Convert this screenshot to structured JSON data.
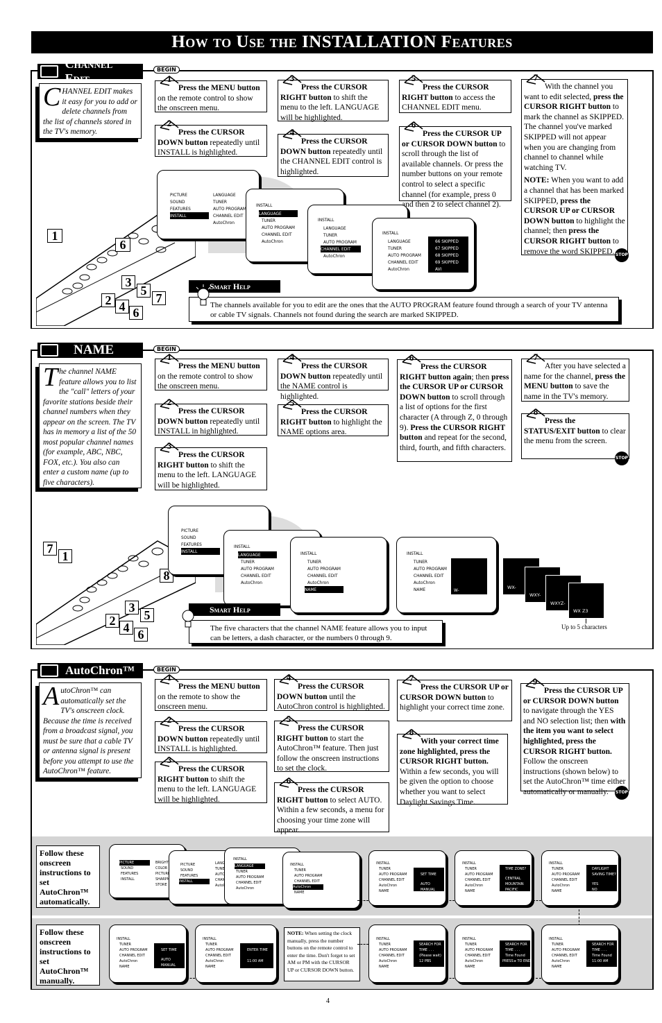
{
  "page_title": {
    "part1": "How to Use the ",
    "part2": "INSTALLATION",
    "part3": " Features"
  },
  "begin_label": "BEGIN",
  "stop_label": "STOP",
  "page_number": "4",
  "channel_edit": {
    "heading": "Channel Edit",
    "intro_drop": "C",
    "intro_text": "HANNEL EDIT makes it easy for you to add or delete channels from the list of channels stored in the TV's memory.",
    "steps": [
      {
        "num": "1",
        "bold": "Press the MENU button",
        "rest": " on the remote control to show the onscreen menu."
      },
      {
        "num": "2",
        "bold": "Press the CURSOR DOWN button",
        "rest": " repeatedly until INSTALL is highlighted."
      },
      {
        "num": "3",
        "bold": "Press the CURSOR RIGHT button",
        "rest": " to shift the menu to the left. LANGUAGE will be highlighted."
      },
      {
        "num": "4",
        "bold": "Press the CURSOR DOWN button",
        "rest": " repeatedly until the CHANNEL EDIT control is highlighted."
      },
      {
        "num": "5",
        "bold": "Press the CURSOR RIGHT button",
        "rest": " to access the CHANNEL EDIT menu."
      },
      {
        "num": "6",
        "bold": "Press the CURSOR UP or CURSOR DOWN button",
        "rest": " to scroll through the list of available channels. Or press the number buttons on your remote control to select a specific channel (for example, press 0 and then 2 to select channel 2)."
      },
      {
        "num": "7",
        "pre": "With the channel you want to edit selected, ",
        "bold": "press the CURSOR RIGHT button",
        "rest": " to mark the channel as SKIPPED. The channel you've marked SKIPPED will not appear when you are changing from channel to channel while watching TV.",
        "note_label": "NOTE:",
        "note_pre": " When you want to add a channel that has been marked SKIPPED, ",
        "note_bold1": "press the CURSOR UP or CURSOR DOWN button",
        "note_mid": " to highlight the channel; then ",
        "note_bold2": "press the CURSOR RIGHT button",
        "note_rest": " to remove the word SKIPPED."
      }
    ],
    "remote_callouts": [
      "1",
      "6",
      "3",
      "5",
      "7",
      "2",
      "4",
      "6"
    ],
    "smart_help_title": "Smart Help",
    "smart_help_text": "The channels available for you to edit are the ones that the AUTO PROGRAM feature found through a search of your TV antenna or cable TV signals.  Channels not found during the search are marked SKIPPED.",
    "screens": {
      "main_menu": [
        "PICTURE",
        "SOUND",
        "FEATURES",
        "INSTALL"
      ],
      "main_submenu": [
        "LANGUAGE",
        "TUNER",
        "AUTO PROGRAM",
        "CHANNEL EDIT",
        "AutoChron"
      ],
      "install_title": "INSTALL",
      "install_items": [
        "LANGUAGE",
        "TUNER",
        "AUTO PROGRAM",
        "CHANNEL EDIT",
        "AutoChron"
      ],
      "channel_list": [
        "66  SKIPPED",
        "67  SKIPPED",
        "68  SKIPPED",
        "69  SKIPPED",
        "AVI"
      ]
    }
  },
  "name": {
    "heading": "NAME",
    "intro_drop": "T",
    "intro_text": "he channel NAME feature allows you to list the \"call\" letters of your favorite stations beside their channel numbers when they appear on the screen.  The TV has in memory a list of the 50 most popular channel names (for example, ABC, NBC, FOX, etc.).  You also can enter a custom name (up to five characters).",
    "steps": [
      {
        "num": "1",
        "bold": "Press the MENU button",
        "rest": " on the remote control to show the onscreen menu."
      },
      {
        "num": "2",
        "bold": "Press the CURSOR DOWN button",
        "rest": " repeatedly until INSTALL in highlighted."
      },
      {
        "num": "3",
        "bold": "Press the CURSOR RIGHT button",
        "rest": " to shift the menu to the left. LANGUAGE will be highlighted."
      },
      {
        "num": "4",
        "bold": "Press the CURSOR DOWN button",
        "rest": " repeatedly until the NAME control is highlighted."
      },
      {
        "num": "5",
        "bold": "Press the CURSOR RIGHT button",
        "rest": " to highlight the NAME options area."
      },
      {
        "num": "6",
        "bold": "Press the CURSOR RIGHT button again",
        "rest": "; then ",
        "bold2": "press the CURSOR UP or CURSOR DOWN button",
        "rest2": " to scroll through a list of options for the first character (A through Z, 0 through 9).  ",
        "bold3": "Press the CURSOR RIGHT button",
        "rest3": " and repeat for the second, third, fourth, and fifth characters."
      },
      {
        "num": "7",
        "pre": "After you have selected a name for the channel, ",
        "bold": "press the MENU button",
        "rest": " to save the name in the TV's memory."
      },
      {
        "num": "8",
        "bold": "Press the STATUS/EXIT button",
        "rest": " to clear the menu from the screen."
      }
    ],
    "remote_callouts": [
      "7",
      "1",
      "8",
      "3",
      "5",
      "2",
      "4",
      "6"
    ],
    "smart_help_title": "Smart Help",
    "smart_help_text": "The five characters that the channel NAME feature allows you to input can be letters, a dash character, or the numbers 0 through 9.",
    "screens": {
      "main_menu": [
        "PICTURE",
        "SOUND",
        "FEATURES",
        "INSTALL"
      ],
      "install_title": "INSTALL",
      "install_items_a": [
        "LANGUAGE",
        "TUNER",
        "AUTO PROGRAM",
        "CHANNEL EDIT",
        "AutoChron"
      ],
      "install_items_b": [
        "TUNER",
        "AUTO PROGRAM",
        "CHANNEL EDIT",
        "AutoChron",
        "NAME"
      ],
      "name_entries": [
        "W-",
        "WX-",
        "WXY-",
        "WXYZ-",
        "WX Z3"
      ],
      "caption": "Up to 5 characters"
    }
  },
  "autochron": {
    "heading": "AutoChron™",
    "intro_drop": "A",
    "intro_text": "utoChron™ can automatically set the TV's onscreen clock.  Because the time is received from a broadcast signal, you must be sure that a cable TV or antenna signal is present before you attempt to use the AutoChron™ feature.",
    "steps": [
      {
        "num": "1",
        "bold": "Press the MENU button",
        "rest": " on the remote to show the onscreen menu."
      },
      {
        "num": "2",
        "bold": "Press the CURSOR DOWN button",
        "rest": " repeatedly until INSTALL is highlighted."
      },
      {
        "num": "3",
        "bold": "Press the CURSOR RIGHT button",
        "rest": " to shift the menu to the left. LANGUAGE will be highlighted."
      },
      {
        "num": "4",
        "bold": "Press the CURSOR DOWN button",
        "rest": " until the AutoChron control is highlighted."
      },
      {
        "num": "5",
        "bold": "Press the CURSOR RIGHT button",
        "rest": " to start the AutoChron™ feature. Then just follow the onscreen instructions to set the clock."
      },
      {
        "num": "6",
        "bold": "Press the CURSOR RIGHT button",
        "rest": " to select AUTO. Within a few seconds, a menu for choosing your time zone will appear."
      },
      {
        "num": "7",
        "bold": "Press the CURSOR UP or CURSOR DOWN button",
        "rest": " to highlight your correct time zone."
      },
      {
        "num": "8",
        "bold": "With your correct time zone highlighted, press the CURSOR RIGHT button.",
        "rest": " Within a few seconds, you will be given the option to choose whether you want to select Daylight Savings Time."
      },
      {
        "num": "9",
        "bold": "Press the CURSOR UP or CURSOR DOWN button",
        "rest": " to navigate through the YES and NO selection list; then ",
        "bold2": "with the item you want to select highlighted, press the CURSOR RIGHT button.",
        "rest2": " Follow the onscreen instructions (shown below) to set the AutoChron™ time either automatically or manually."
      }
    ],
    "auto_label": "Follow these onscreen instructions to set AutoChron™ automatically.",
    "manual_label": "Follow these onscreen instructions to set AutoChron™ manually.",
    "screens": {
      "main_menu": [
        "PICTURE",
        "SOUND",
        "FEATURES",
        "INSTALL"
      ],
      "picture_submenu": [
        "BRIGHTNESS",
        "COLOR",
        "PICTURE",
        "SHARPNESS",
        "STORE"
      ],
      "install_submenu": [
        "LANGUAGE",
        "TUNER",
        "AUTO PROGRAM",
        "CHANNEL",
        "AutoChron"
      ],
      "install_title": "INSTALL",
      "install_items_a": [
        "LANGUAGE",
        "TUNER",
        "AUTO PROGRAM",
        "CHANNEL EDIT",
        "AutoChron"
      ],
      "install_items_b": [
        "TUNER",
        "AUTO PROGRAM",
        "CHANNEL EDIT",
        "AutoChron",
        "NAME"
      ],
      "set_time": {
        "title": "SET TIME",
        "options": [
          "AUTO",
          "MANUAL"
        ]
      },
      "time_zone": {
        "title": "TIME ZONE?",
        "options": [
          "CENTRAL",
          "MOUNTAIN",
          "PACIFIC"
        ]
      },
      "dst": {
        "title1": "DAYLIGHT",
        "title2": "SAVING TIME?",
        "options": [
          "YES",
          "NO"
        ]
      },
      "enter_time": {
        "title": "ENTER TIME",
        "value": "11:00 AM"
      },
      "search1": [
        "SEARCH FOR",
        "TIME . . .",
        "(Please wait)",
        "12 PBS"
      ],
      "search2": [
        "SEARCH FOR",
        "TIME . . .",
        "Time Found",
        "PRESS ▸ TO END"
      ],
      "search3": [
        "SEARCH FOR",
        "TIME . . .",
        "Time Found",
        "11:00 AM"
      ]
    },
    "note_label": "NOTE:",
    "note_text": " When setting the clock manually, press the number buttons on the remote control to enter the time. Don't forget to set AM or PM with the CURSOR UP or CURSOR DOWN button."
  }
}
